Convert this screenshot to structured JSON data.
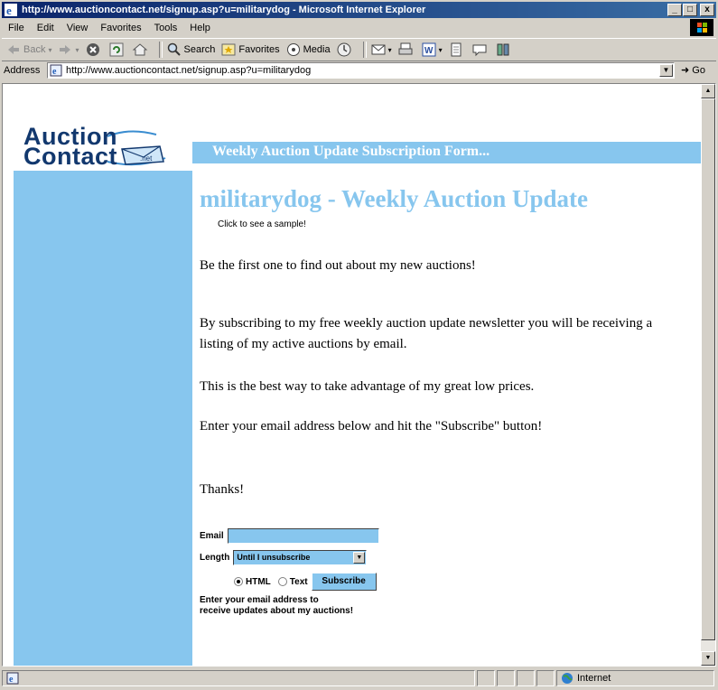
{
  "window": {
    "title": "http://www.auctioncontact.net/signup.asp?u=militarydog - Microsoft Internet Explorer",
    "controls": [
      "_",
      "□",
      "x"
    ]
  },
  "menu": [
    "File",
    "Edit",
    "View",
    "Favorites",
    "Tools",
    "Help"
  ],
  "toolbar": {
    "back": "Back",
    "search": "Search",
    "favorites": "Favorites",
    "media": "Media"
  },
  "address": {
    "label": "Address",
    "url": "http://www.auctioncontact.net/signup.asp?u=militarydog",
    "go": "Go"
  },
  "page": {
    "logo_line1": "Auction",
    "logo_line2": "Contact",
    "logo_tag": ".net",
    "banner": "Weekly Auction Update Subscription Form...",
    "heading": "militarydog - Weekly Auction Update",
    "sample_link": "Click to see a sample!",
    "para1": "Be the first one to find out about my new auctions!",
    "para2": "By subscribing to my free weekly auction update newsletter you will be receiving a listing of my active auctions by email.",
    "para3": "This is the best way to take advantage of my great low prices.",
    "para4": "Enter your email address below and hit the \"Subscribe\" button!",
    "para5": "Thanks!",
    "form": {
      "email_label": "Email",
      "email_value": "",
      "length_label": "Length",
      "length_value": "Until I unsubscribe",
      "html_label": "HTML",
      "text_label": "Text",
      "selected_format": "HTML",
      "subscribe": "Subscribe",
      "note_line1": "Enter your email address to",
      "note_line2": "receive updates about my auctions!"
    }
  },
  "status": {
    "zone": "Internet"
  },
  "colors": {
    "accent": "#87c6ee",
    "logo": "#12386e",
    "titlebar": "#0a246a"
  }
}
